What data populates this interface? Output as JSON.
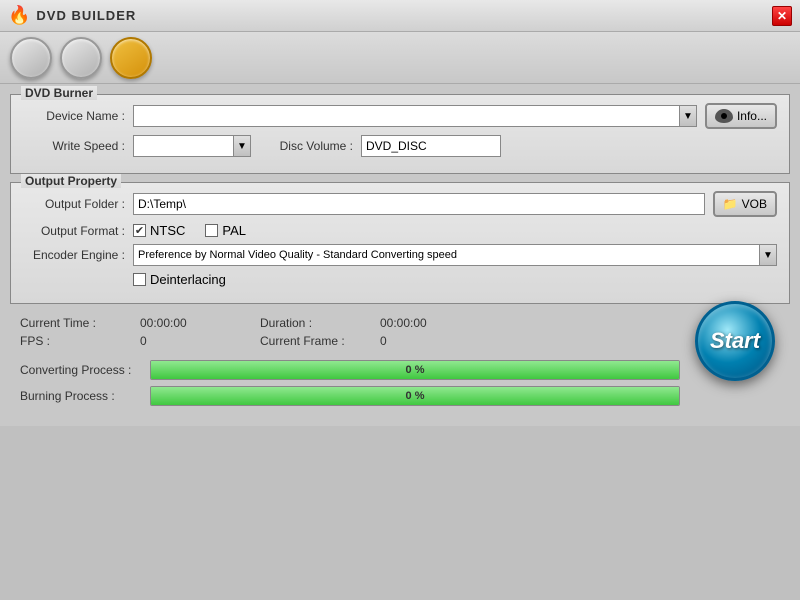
{
  "titleBar": {
    "title": "DVD BUILDER",
    "closeLabel": "✕"
  },
  "toolbar": {
    "buttons": [
      {
        "id": "btn1",
        "active": false
      },
      {
        "id": "btn2",
        "active": false
      },
      {
        "id": "btn3",
        "active": true
      }
    ]
  },
  "dvdBurner": {
    "groupTitle": "DVD Burner",
    "deviceNameLabel": "Device Name :",
    "deviceNameValue": "",
    "deviceNamePlaceholder": "",
    "infoButtonLabel": "Info...",
    "writeSpeedLabel": "Write Speed :",
    "writeSpeedValue": "",
    "discVolumeLabel": "Disc Volume :",
    "discVolumeValue": "DVD_DISC"
  },
  "outputProperty": {
    "groupTitle": "Output Property",
    "outputFolderLabel": "Output Folder :",
    "outputFolderValue": "D:\\Temp\\",
    "vobButtonLabel": "VOB",
    "outputFormatLabel": "Output Format :",
    "ntscLabel": "NTSC",
    "ntscChecked": true,
    "palLabel": "PAL",
    "palChecked": false,
    "encoderEngineLabel": "Encoder Engine :",
    "encoderEngineValue": "Preference by Normal Video Quality - Standard Converting speed",
    "deinterlacingLabel": "Deinterlacing",
    "deinterlacingChecked": false
  },
  "status": {
    "currentTimeLabel": "Current Time :",
    "currentTimeValue": "00:00:00",
    "durationLabel": "Duration :",
    "durationValue": "00:00:00",
    "fpsLabel": "FPS :",
    "fpsValue": "0",
    "currentFrameLabel": "Current Frame :",
    "currentFrameValue": "0"
  },
  "progress": {
    "convertingLabel": "Converting Process :",
    "convertingValue": "0 %",
    "burningLabel": "Burning Process :",
    "burningValue": "0 %"
  },
  "startButton": {
    "label": "Start"
  }
}
